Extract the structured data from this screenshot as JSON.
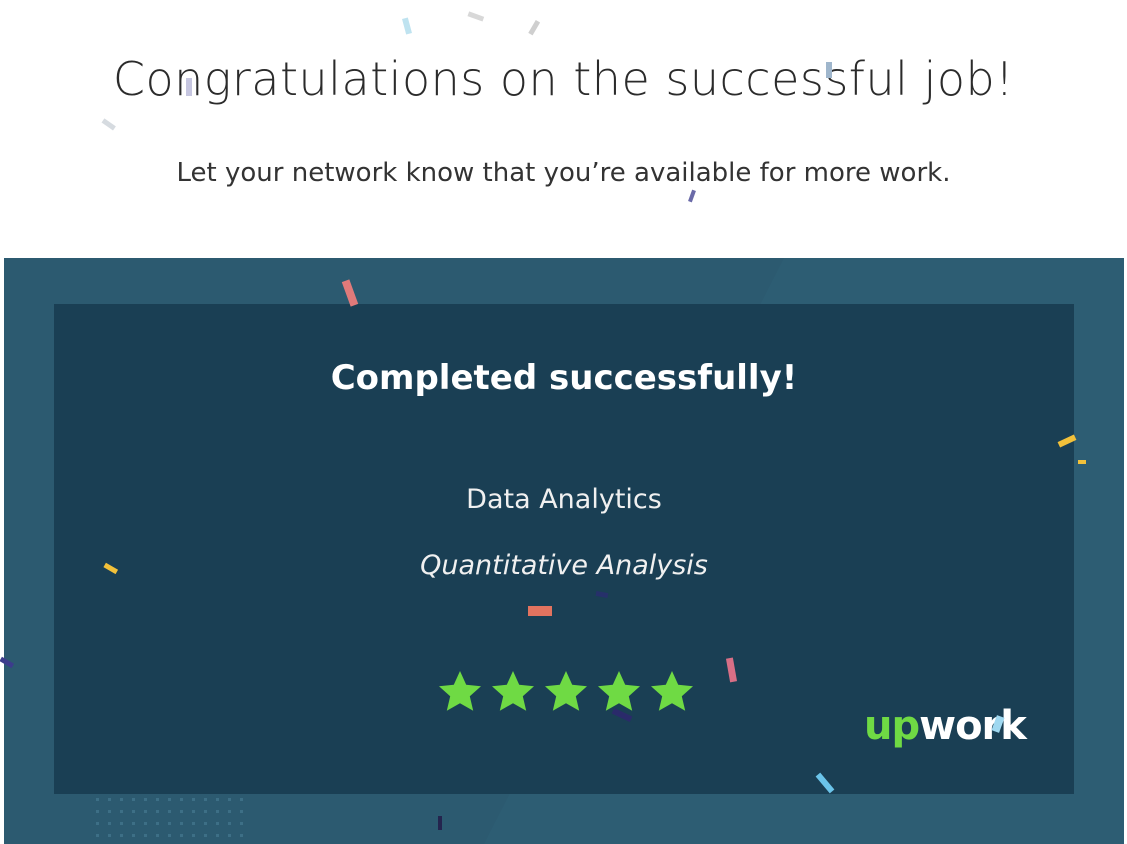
{
  "header": {
    "title": "Congratulations on the successful job!",
    "subtitle": "Let your network know that you’re available for more work."
  },
  "card": {
    "status": "Completed successfully!",
    "category": "Data Analytics",
    "subcategory": "Quantitative Analysis",
    "rating": 5,
    "rating_max": 5,
    "logo_up": "up",
    "logo_work": "work"
  },
  "colors": {
    "card_outer": "#2c5a70",
    "card_inner": "#1a3f54",
    "star": "#6fda44",
    "brand_green": "#6fda44"
  },
  "icons": [
    "star-icon",
    "upwork-logo",
    "confetti"
  ]
}
